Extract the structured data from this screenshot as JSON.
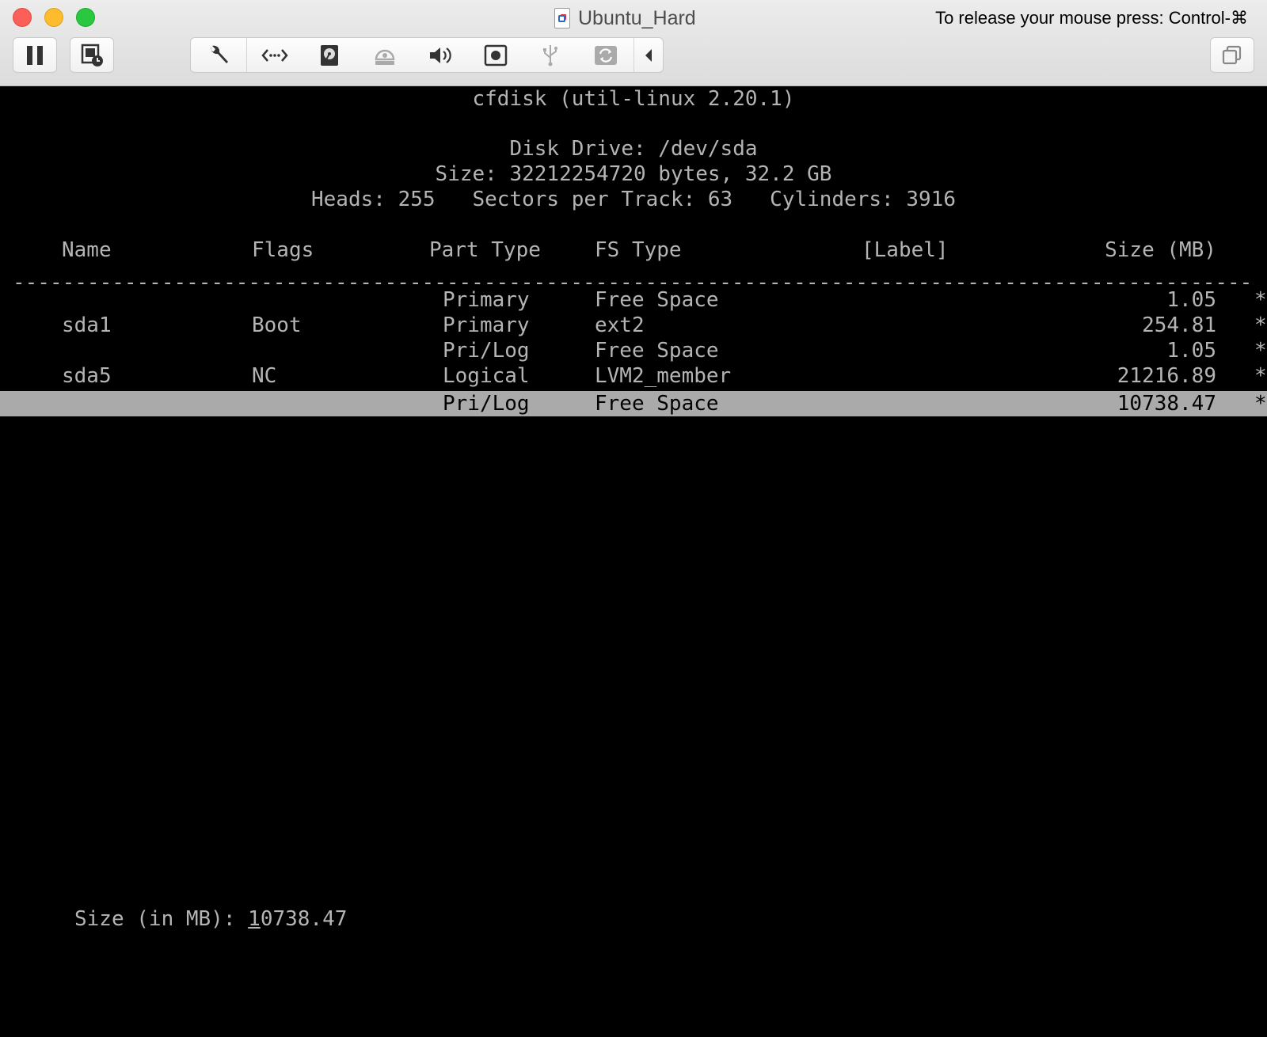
{
  "window": {
    "title": "Ubuntu_Hard",
    "release_hint": "To release your mouse press: Control-⌘"
  },
  "toolbar": {
    "icons": [
      "pause-icon",
      "snapshot-icon",
      "settings-wrench-icon",
      "network-icon",
      "hard-disk-icon",
      "optical-drive-icon",
      "sound-icon",
      "camera-icon",
      "usb-icon",
      "shared-folders-icon",
      "collapse-arrow-icon",
      "fullscreen-icon"
    ]
  },
  "cfdisk": {
    "header": "cfdisk (util-linux 2.20.1)",
    "disk_drive": "Disk Drive: /dev/sda",
    "size_line": "Size: 32212254720 bytes, 32.2 GB",
    "geometry_line": "Heads: 255   Sectors per Track: 63   Cylinders: 3916",
    "columns": {
      "name": "Name",
      "flags": "Flags",
      "part_type": "Part Type",
      "fs_type": "FS Type",
      "label": "[Label]",
      "size": "Size (MB)"
    },
    "separator": "------------------------------------------------------------------------------------------------------------------------------------------------------------",
    "rows": [
      {
        "name": "",
        "flags": "",
        "part_type": "Primary",
        "fs_type": "Free Space",
        "label": "",
        "size": "1.05",
        "mark": "*"
      },
      {
        "name": "sda1",
        "flags": "Boot",
        "part_type": "Primary",
        "fs_type": "ext2",
        "label": "",
        "size": "254.81",
        "mark": "*"
      },
      {
        "name": "",
        "flags": "",
        "part_type": "Pri/Log",
        "fs_type": "Free Space",
        "label": "",
        "size": "1.05",
        "mark": "*"
      },
      {
        "name": "sda5",
        "flags": "NC",
        "part_type": "Logical",
        "fs_type": "LVM2_member",
        "label": "",
        "size": "21216.89",
        "mark": "*"
      },
      {
        "name": "",
        "flags": "",
        "part_type": "Pri/Log",
        "fs_type": "Free Space",
        "label": "",
        "size": "10738.47",
        "mark": "*",
        "selected": true
      }
    ],
    "prompt": {
      "label": "Size (in MB): ",
      "value_first_char": "1",
      "value_rest": "0738.47"
    }
  }
}
